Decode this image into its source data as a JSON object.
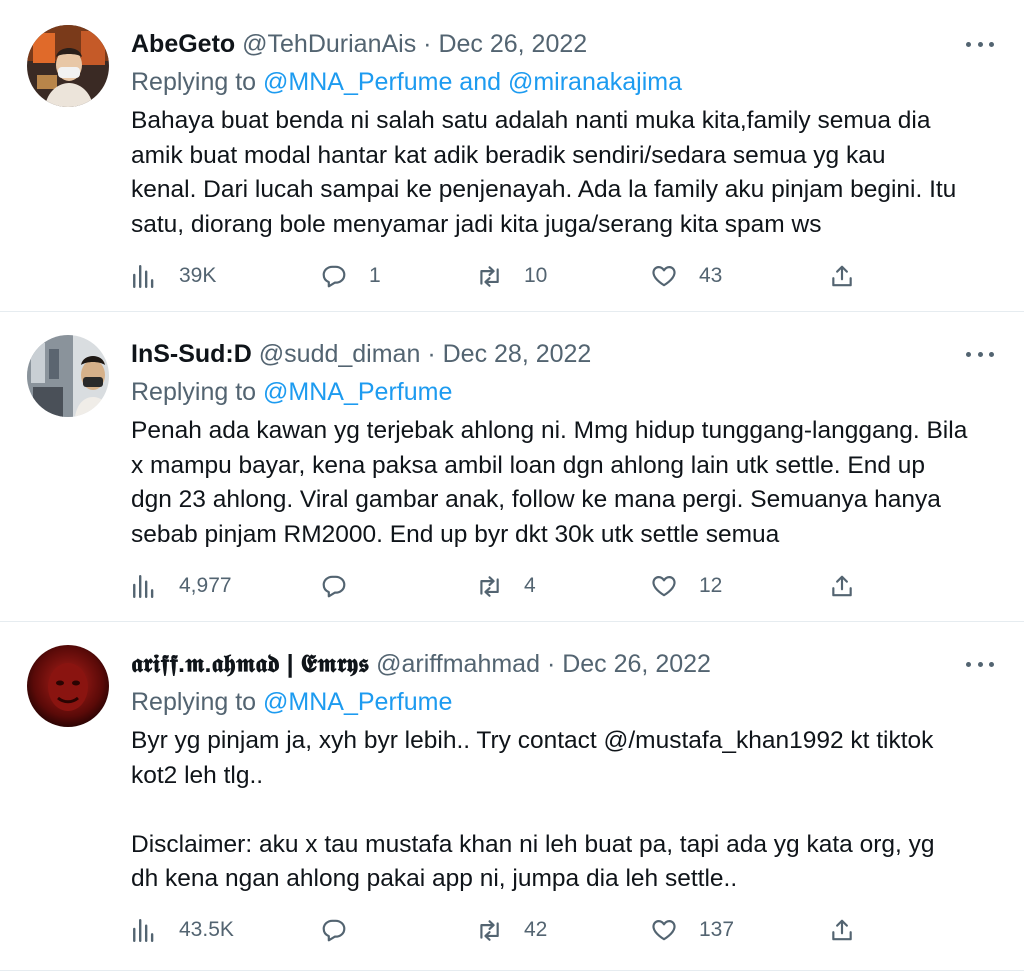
{
  "tweets": [
    {
      "name": "AbeGeto",
      "handle": "@TehDurianAis",
      "separator": "·",
      "date": "Dec 26, 2022",
      "replying_prefix": "Replying to",
      "replying_mentions": "@MNA_Perfume and @miranakajima",
      "text": "Bahaya buat benda ni salah satu adalah nanti muka kita,family semua dia\namik buat modal hantar kat adik beradik sendiri/sedara semua yg kau\nkenal. Dari lucah sampai ke penjenayah. Ada la family aku pinjam begini. Itu\nsatu, diorang bole menyamar jadi kita juga/serang kita spam ws",
      "views": "39K",
      "replies": "1",
      "retweets": "10",
      "likes": "43"
    },
    {
      "name": "InS-Sud:D",
      "handle": "@sudd_diman",
      "separator": "·",
      "date": "Dec 28, 2022",
      "replying_prefix": "Replying to",
      "replying_mentions": "@MNA_Perfume",
      "text": "Penah ada kawan yg terjebak ahlong ni. Mmg hidup tunggang-langgang. Bila\nx mampu bayar, kena paksa ambil loan dgn ahlong lain utk settle. End up\ndgn 23 ahlong. Viral gambar anak, follow ke mana pergi. Semuanya hanya\nsebab pinjam RM2000. End up byr dkt 30k utk settle semua",
      "views": "4,977",
      "replies": "",
      "retweets": "4",
      "likes": "12"
    },
    {
      "name": "𝖆𝖗𝖎𝖋𝖋.𝖒.𝖆𝖍𝖒𝖆𝖉 | 𝕰𝖒𝖗𝖞𝖘",
      "handle": "@ariffmahmad",
      "separator": "·",
      "date": "Dec 26, 2022",
      "replying_prefix": "Replying to",
      "replying_mentions": "@MNA_Perfume",
      "text": "Byr yg pinjam ja, xyh byr lebih.. Try contact @/mustafa_khan1992 kt tiktok\nkot2 leh tlg..\n\nDisclaimer: aku x tau mustafa khan ni leh buat pa, tapi ada yg kata org, yg\ndh kena ngan ahlong pakai app ni, jumpa dia leh settle..",
      "views": "43.5K",
      "replies": "",
      "retweets": "42",
      "likes": "137"
    }
  ],
  "icons": {
    "views": "bar-chart-icon",
    "reply": "speech-bubble-icon",
    "retweet": "retweet-arrows-icon",
    "like": "heart-icon",
    "share": "share-upload-icon",
    "more": "more-horizontal-icon"
  },
  "colors": {
    "text": "#0f1419",
    "secondary": "#536471",
    "link": "#1d9bf0",
    "divider": "#e6ecf0"
  }
}
